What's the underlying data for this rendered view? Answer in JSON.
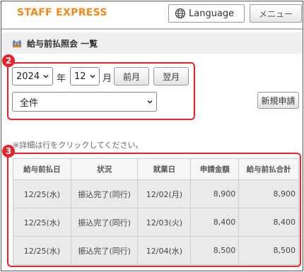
{
  "header": {
    "brand": "STAFF EXPRESS",
    "language_label": "Language",
    "menu_label": "メニュー"
  },
  "page": {
    "title": "給与前払照会 一覧"
  },
  "badges": [
    "2",
    "3"
  ],
  "filters": {
    "year": "2024",
    "year_suffix": "年",
    "month": "12",
    "month_suffix": "月",
    "prev_month_label": "前月",
    "next_month_label": "翌月",
    "status_selected": "全件",
    "new_request_label": "新規申請"
  },
  "note": "※詳細は行をクリックしてください。",
  "table": {
    "columns": [
      "給与前払日",
      "状況",
      "就業日",
      "申請金額",
      "給与前払合計"
    ],
    "rows": [
      [
        "12/25(水)",
        "振込完了(同行)",
        "12/02(月)",
        "8,900",
        "8,900"
      ],
      [
        "12/25(水)",
        "振込完了(同行)",
        "12/03(火)",
        "8,400",
        "8,400"
      ],
      [
        "12/25(水)",
        "振込完了(同行)",
        "12/04(水)",
        "8,500",
        "8,500"
      ]
    ]
  },
  "colors": {
    "brand": "#f08a1c",
    "annotation": "#e8232a"
  }
}
